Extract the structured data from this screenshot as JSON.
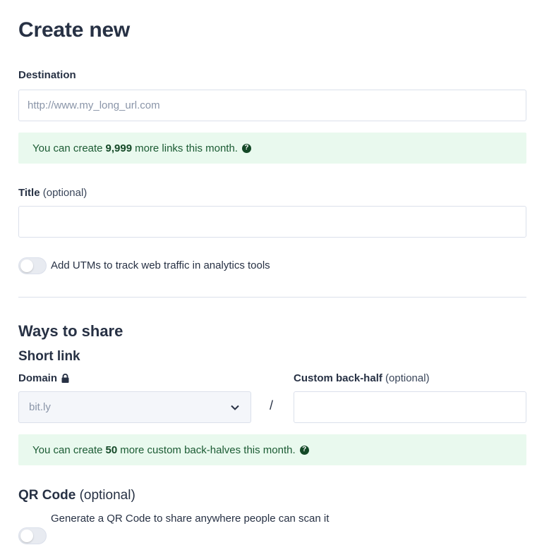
{
  "page_title": "Create new",
  "destination": {
    "label": "Destination",
    "placeholder": "http://www.my_long_url.com",
    "value": ""
  },
  "links_notice": {
    "prefix": "You can create",
    "count": "9,999",
    "suffix": "more links this month.",
    "help_icon": "question-circle-icon"
  },
  "title_field": {
    "label": "Title",
    "optional": "(optional)",
    "value": ""
  },
  "utm_toggle": {
    "label": "Add UTMs to track web traffic in analytics tools",
    "on": false
  },
  "ways_to_share": {
    "heading": "Ways to share",
    "short_link_heading": "Short link",
    "domain_label": "Domain",
    "domain_lock_icon": "lock-icon",
    "domain_value": "bit.ly",
    "separator": "/",
    "custom_label": "Custom back-half",
    "custom_optional": "(optional)",
    "custom_value": ""
  },
  "backhalf_notice": {
    "prefix": "You can create",
    "count": "50",
    "suffix": "more custom back-halves this month.",
    "help_icon": "question-circle-icon"
  },
  "qr_code": {
    "heading": "QR Code",
    "optional": "(optional)",
    "toggle_label": "Generate a QR Code to share anywhere people can scan it",
    "on": false
  },
  "colors": {
    "heading": "#273144",
    "notice_bg": "#e9f9ee",
    "notice_text": "#134826",
    "border": "#dbe0eb"
  }
}
